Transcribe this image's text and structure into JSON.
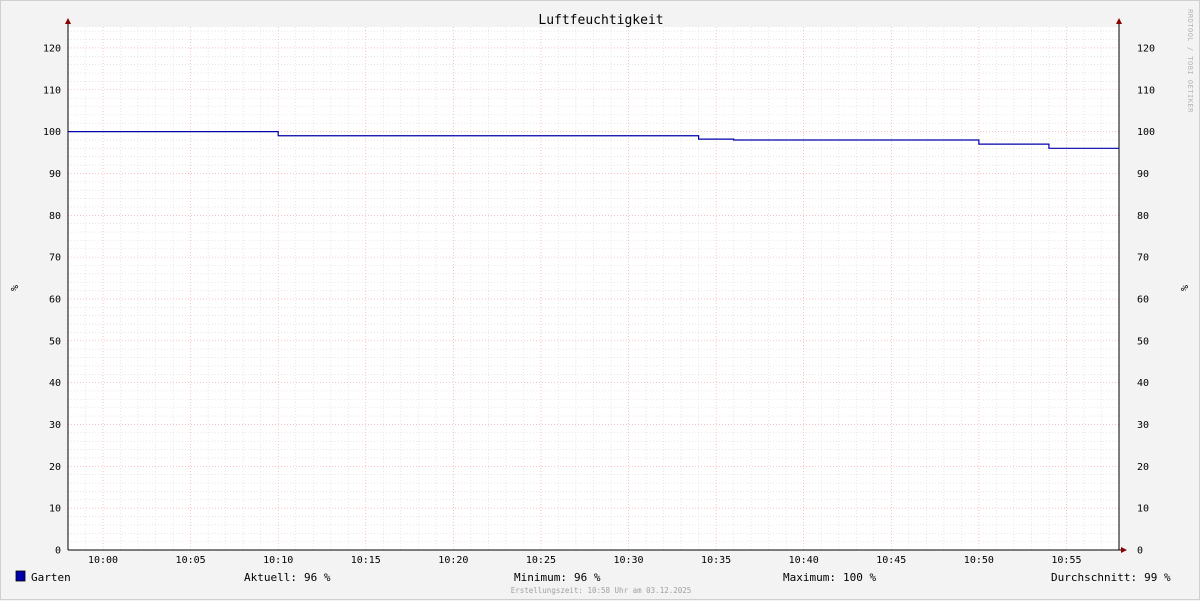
{
  "colors": {
    "series": "#0000aa",
    "legend_swatch": "#0000aa",
    "canvas": "#ffffff",
    "background": "#f3f3f3",
    "grid_major": "#f0a0a0",
    "grid_minor": "#d8d8d8",
    "axis": "#000000",
    "arrow": "#8b0000"
  },
  "watermark": "RRDTOOL / TOBI OETIKER",
  "footer": "Erstellungszeit: 10:58 Uhr am 03.12.2025",
  "chart_data": {
    "type": "line",
    "title": "Luftfeuchtigkeit",
    "ylabel": "%",
    "ylabel_right": "%",
    "xlabel": "",
    "grid": true,
    "xlim": [
      "09:58",
      "10:58"
    ],
    "ylim": [
      0,
      125
    ],
    "x_ticks": [
      "10:00",
      "10:05",
      "10:10",
      "10:15",
      "10:20",
      "10:25",
      "10:30",
      "10:35",
      "10:40",
      "10:45",
      "10:50",
      "10:55"
    ],
    "y_ticks": [
      0,
      10,
      20,
      30,
      40,
      50,
      60,
      70,
      80,
      90,
      100,
      110,
      120
    ],
    "series": [
      {
        "name": "Garten",
        "step": true,
        "points": [
          {
            "x": "09:58",
            "y": 100
          },
          {
            "x": "10:10",
            "y": 99
          },
          {
            "x": "10:34",
            "y": 98.2
          },
          {
            "x": "10:36",
            "y": 98
          },
          {
            "x": "10:50",
            "y": 97
          },
          {
            "x": "10:54",
            "y": 96
          },
          {
            "x": "10:58",
            "y": 96
          }
        ]
      }
    ],
    "legend": {
      "series_name": "Garten",
      "stats": [
        {
          "label": "Aktuell:",
          "value": "96 %"
        },
        {
          "label": "Minimum:",
          "value": "96 %"
        },
        {
          "label": "Maximum:",
          "value": "100 %"
        },
        {
          "label": "Durchschnitt:",
          "value": "99 %"
        }
      ]
    }
  }
}
